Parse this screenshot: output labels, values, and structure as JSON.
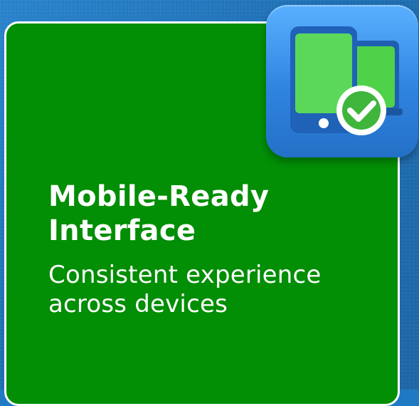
{
  "feature": {
    "title_line1": "Mobile-Ready",
    "title_line2": "Interface",
    "subtitle_line1": "Consistent experience",
    "subtitle_line2": "across devices"
  },
  "icons": {
    "app_icon": "device-responsive-check-icon"
  },
  "colors": {
    "card_green": "#028e05",
    "icon_blue": "#2f84e0",
    "screen_green": "#4fd14a",
    "check_green": "#3fb53c",
    "text_white": "#ffffff"
  }
}
